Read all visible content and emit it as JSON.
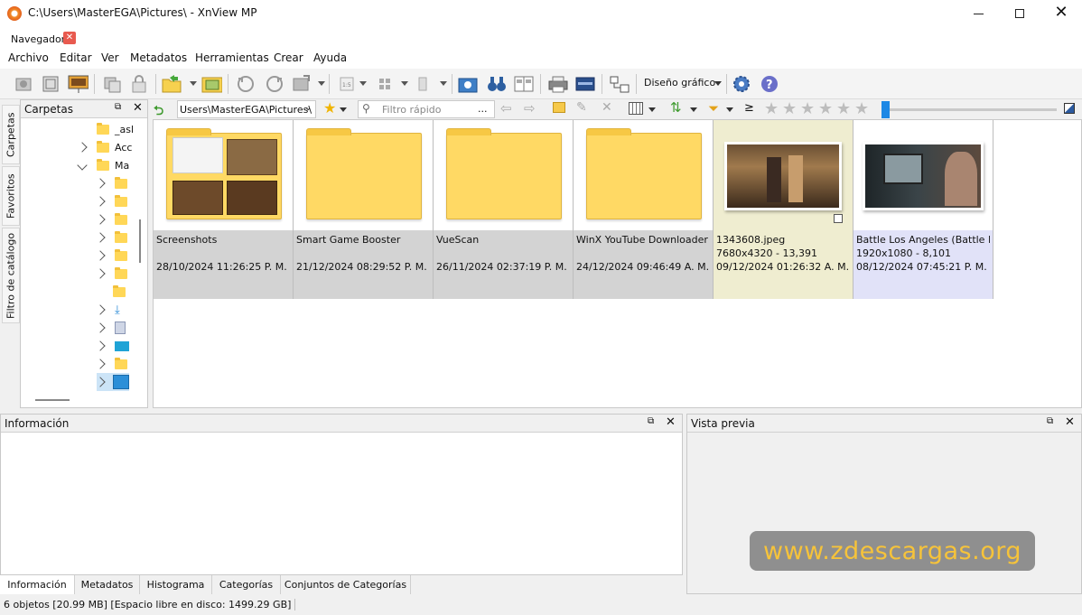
{
  "window": {
    "title": "C:\\Users\\MasterEGA\\Pictures\\ - XnView MP"
  },
  "tab": {
    "label": "Navegador"
  },
  "menu": [
    "Archivo",
    "Editar",
    "Ver",
    "Metadatos",
    "Herramientas",
    "Crear",
    "Ayuda"
  ],
  "toolbar": {
    "layout_label": "Diseño gráfico"
  },
  "sidetabs": [
    "Carpetas",
    "Favoritos",
    "Filtro de catálogo"
  ],
  "folders_panel": {
    "title": "Carpetas",
    "items": [
      "_asl",
      "Acc",
      "Ma"
    ]
  },
  "address": {
    "path": "Users\\MasterEGA\\Pictures\\",
    "filter_placeholder": "Filtro rápido",
    "filter_more": "...",
    "ge": "≥"
  },
  "files": [
    {
      "name": "Screenshots",
      "line2": "",
      "date": "28/10/2024 11:26:25 P. M."
    },
    {
      "name": "Smart Game Booster",
      "line2": "",
      "date": "21/12/2024 08:29:52 P. M."
    },
    {
      "name": "VueScan",
      "line2": "",
      "date": "26/11/2024 02:37:19 P. M."
    },
    {
      "name": "WinX YouTube Downloader",
      "line2": "",
      "date": "24/12/2024 09:46:49 A. M."
    },
    {
      "name": "1343608.jpeg",
      "line2": "7680x4320 - 13,391",
      "date": "09/12/2024 01:26:32 A. M."
    },
    {
      "name": "Battle Los Angeles (Battle L...",
      "line2": "1920x1080 - 8,101",
      "date": "08/12/2024 07:45:21 P. M."
    }
  ],
  "info_panel": {
    "title": "Información"
  },
  "preview_panel": {
    "title": "Vista previa"
  },
  "bottom_tabs": [
    "Información",
    "Metadatos",
    "Histograma",
    "Categorías",
    "Conjuntos de Categorías"
  ],
  "status": "6 objetos [20.99 MB] [Espacio libre en disco: 1499.29 GB]",
  "watermark": "www.zdescargas.org",
  "colors": {
    "selected_image_bg": "#efedd0",
    "selected_image2_bg": "#e1e2f8",
    "folder_meta_bg": "#d3d3d3",
    "accent_slider": "#1e88e5"
  }
}
